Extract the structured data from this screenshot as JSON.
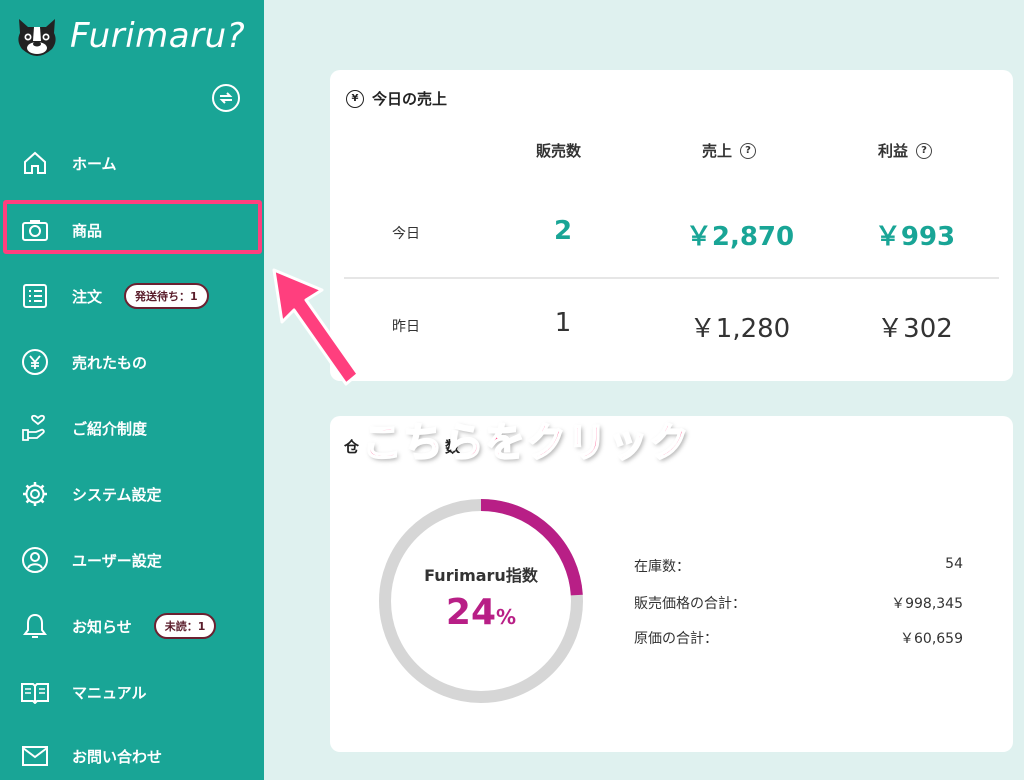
{
  "brand": {
    "name": "Furimaru?"
  },
  "sidebar": {
    "items": [
      {
        "label": "ホーム",
        "icon": "home-icon"
      },
      {
        "label": "商品",
        "icon": "camera-icon"
      },
      {
        "label": "注文",
        "icon": "list-icon",
        "badge": "発送待ち：1"
      },
      {
        "label": "売れたもの",
        "icon": "yen-icon"
      },
      {
        "label": "ご紹介制度",
        "icon": "hand-heart-icon"
      },
      {
        "label": "システム設定",
        "icon": "gear-icon"
      },
      {
        "label": "ユーザー設定",
        "icon": "user-icon"
      },
      {
        "label": "お知らせ",
        "icon": "bell-icon",
        "badge": "未読：1"
      },
      {
        "label": "マニュアル",
        "icon": "book-icon"
      },
      {
        "label": "お問い合わせ",
        "icon": "mail-icon"
      }
    ]
  },
  "sales": {
    "title": "今日の売上",
    "columns": [
      "販売数",
      "売上",
      "利益"
    ],
    "rows": [
      {
        "label": "今日",
        "count": "2",
        "sales": "￥2,870",
        "profit": "￥993"
      },
      {
        "label": "昨日",
        "count": "1",
        "sales": "￥1,280",
        "profit": "￥302"
      }
    ]
  },
  "inventory": {
    "title_partial": "仓",
    "title_tail": "数",
    "index_label": "Furimaru指数",
    "index_value": "24",
    "index_unit": "%",
    "index_fraction": 0.24,
    "stats": [
      {
        "label": "在庫数：",
        "value": "54"
      },
      {
        "label": "販売価格の合計：",
        "value": "￥998,345"
      },
      {
        "label": "原価の合計：",
        "value": "￥60,659"
      }
    ]
  },
  "annotation": {
    "text": "こちらをクリック"
  },
  "colors": {
    "teal": "#19a596",
    "magenta": "#b81f86",
    "highlight": "#ff3f7e",
    "badge_border": "#6b2131"
  }
}
